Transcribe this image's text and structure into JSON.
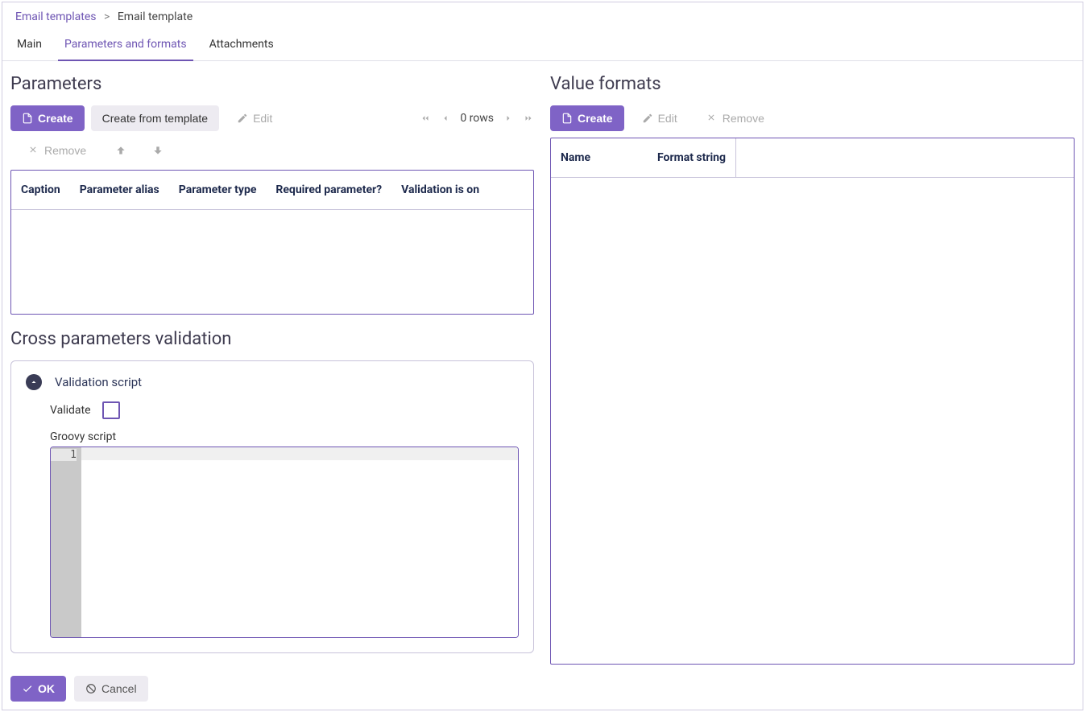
{
  "breadcrumb": {
    "root": "Email templates",
    "current": "Email template"
  },
  "tabs": {
    "main": "Main",
    "params": "Parameters and formats",
    "attachments": "Attachments"
  },
  "parameters": {
    "title": "Parameters",
    "create": "Create",
    "create_from_template": "Create from template",
    "edit": "Edit",
    "remove": "Remove",
    "rows": "0 rows",
    "columns": {
      "caption": "Caption",
      "alias": "Parameter alias",
      "type": "Parameter type",
      "required": "Required parameter?",
      "validation": "Validation is on"
    }
  },
  "cross": {
    "title": "Cross parameters validation",
    "script_header": "Validation script",
    "validate_label": "Validate",
    "groovy_label": "Groovy script",
    "line_number": "1"
  },
  "formats": {
    "title": "Value formats",
    "create": "Create",
    "edit": "Edit",
    "remove": "Remove",
    "columns": {
      "name": "Name",
      "format": "Format string"
    }
  },
  "footer": {
    "ok": "OK",
    "cancel": "Cancel"
  }
}
